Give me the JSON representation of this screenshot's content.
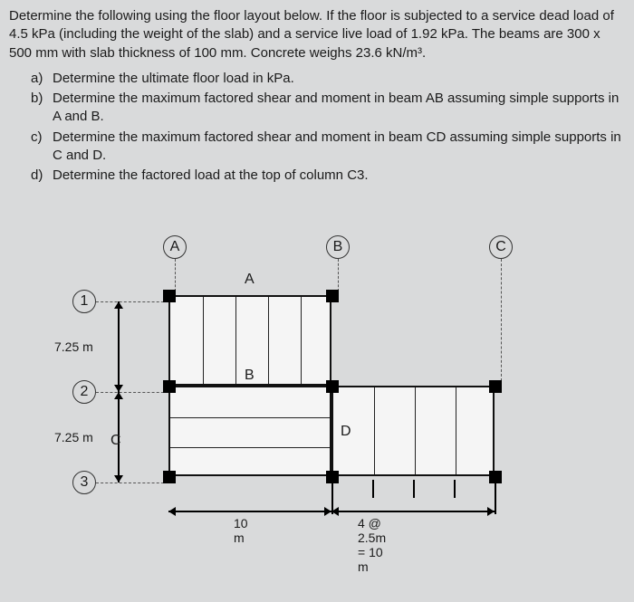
{
  "problem": {
    "intro": "Determine the following using the floor layout below. If the floor is subjected to a service dead load of 4.5 kPa (including the weight of the slab) and a service live load of 1.92 kPa. The beams are 300 x 500 mm with slab thickness of 100 mm. Concrete weighs 23.6 kN/m³.",
    "questions": [
      {
        "label": "a)",
        "text": "Determine the ultimate floor load in kPa."
      },
      {
        "label": "b)",
        "text": "Determine the maximum factored shear and moment in beam AB assuming simple supports in A and B."
      },
      {
        "label": "c)",
        "text": "Determine the maximum factored shear and moment in beam CD assuming simple supports in C and D."
      },
      {
        "label": "d)",
        "text": "Determine the factored load at the top of column C3."
      }
    ]
  },
  "diagram": {
    "grid_cols": [
      "A",
      "B",
      "C"
    ],
    "grid_rows": [
      "1",
      "2",
      "3"
    ],
    "row_dims": [
      "7.25 m",
      "7.25 m"
    ],
    "bottom_dim_left": "10 m",
    "bottom_dim_right": "4 @ 2.5m = 10 m",
    "beam_labels": {
      "ab": "A",
      "cd_left": "B",
      "cd_leftpt": "C",
      "cd_rightpt": "D"
    }
  }
}
